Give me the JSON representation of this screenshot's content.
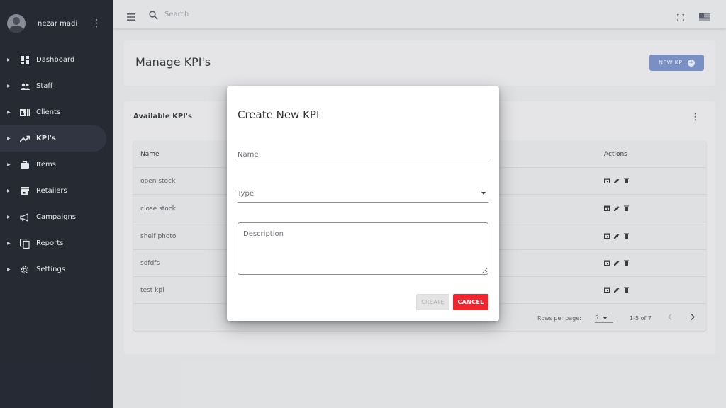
{
  "sidebar": {
    "username": "nezar madi",
    "items": [
      {
        "label": "Dashboard",
        "icon": "dashboard-icon",
        "active": false
      },
      {
        "label": "Staff",
        "icon": "people-icon",
        "active": false
      },
      {
        "label": "Clients",
        "icon": "contacts-icon",
        "active": false
      },
      {
        "label": "KPI's",
        "icon": "trending-up-icon",
        "active": true
      },
      {
        "label": "Items",
        "icon": "briefcase-icon",
        "active": false
      },
      {
        "label": "Retailers",
        "icon": "store-icon",
        "active": false
      },
      {
        "label": "Campaigns",
        "icon": "megaphone-icon",
        "active": false
      },
      {
        "label": "Reports",
        "icon": "reports-icon",
        "active": false
      },
      {
        "label": "Settings",
        "icon": "gear-icon",
        "active": false
      }
    ]
  },
  "topbar": {
    "search_placeholder": "Search"
  },
  "header": {
    "title": "Manage KPI's",
    "new_button": "NEW KPI"
  },
  "table": {
    "title": "Available KPI's",
    "columns": {
      "name": "Name",
      "actions": "Actions"
    },
    "rows": [
      {
        "name": "open stock"
      },
      {
        "name": "close stock"
      },
      {
        "name": "shelf photo"
      },
      {
        "name": "sdfdfs"
      },
      {
        "name": "test kpi"
      }
    ],
    "footer": {
      "rows_per_page_label": "Rows per page:",
      "rows_per_page": "5",
      "range": "1-5 of 7"
    }
  },
  "modal": {
    "title": "Create New KPI",
    "name_placeholder": "Name",
    "type_label": "Type",
    "description_placeholder": "Description",
    "create_label": "CREATE",
    "cancel_label": "CANCEL"
  },
  "colors": {
    "sidebar_bg": "#272b35",
    "primary_button": "#7d93c9",
    "cancel_button": "#f0262f",
    "page_bg": "#e4e5e7"
  }
}
